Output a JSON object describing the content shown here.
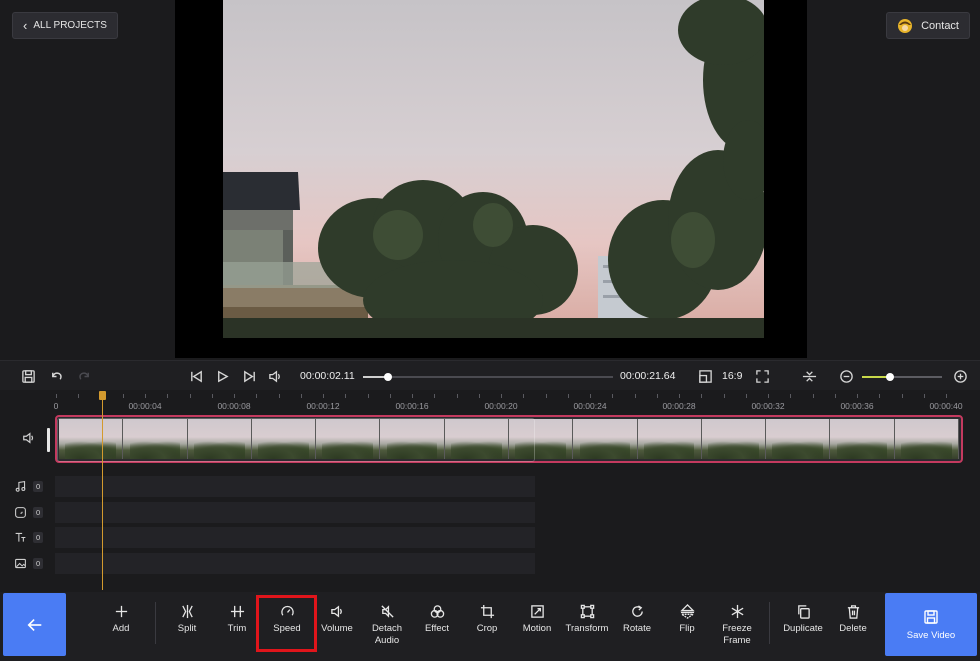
{
  "header": {
    "all_projects_label": "ALL PROJECTS",
    "contact_label": "Contact"
  },
  "playbar": {
    "current_time": "00:00:02.11",
    "total_time": "00:00:21.64",
    "progress_fraction": 0.1,
    "aspect_ratio": "16:9",
    "zoom_fraction": 0.35
  },
  "timeline": {
    "ruler_ticks": [
      "0",
      "00:00:04",
      "00:00:08",
      "00:00:12",
      "00:00:16",
      "00:00:20",
      "00:00:24",
      "00:00:28",
      "00:00:32",
      "00:00:36",
      "00:00:40"
    ],
    "sub_tracks": [
      {
        "icon": "music-icon",
        "count": "0"
      },
      {
        "icon": "sticker-icon",
        "count": "0"
      },
      {
        "icon": "text-icon",
        "count": "0"
      },
      {
        "icon": "image-icon",
        "count": "0"
      }
    ]
  },
  "toolbar": {
    "tools": [
      {
        "id": "add",
        "label": "Add"
      },
      {
        "id": "split",
        "label": "Split"
      },
      {
        "id": "trim",
        "label": "Trim"
      },
      {
        "id": "speed",
        "label": "Speed"
      },
      {
        "id": "volume",
        "label": "Volume"
      },
      {
        "id": "detach-audio",
        "label": "Detach\nAudio"
      },
      {
        "id": "effect",
        "label": "Effect"
      },
      {
        "id": "crop",
        "label": "Crop"
      },
      {
        "id": "motion",
        "label": "Motion"
      },
      {
        "id": "transform",
        "label": "Transform"
      },
      {
        "id": "rotate",
        "label": "Rotate"
      },
      {
        "id": "flip",
        "label": "Flip"
      },
      {
        "id": "freeze-frame",
        "label": "Freeze\nFrame"
      },
      {
        "id": "duplicate",
        "label": "Duplicate"
      },
      {
        "id": "delete",
        "label": "Delete"
      }
    ],
    "save_video_label": "Save Video"
  },
  "colors": {
    "accent_blue": "#4a7cf4",
    "track_border": "#c43a5f",
    "playhead": "#d39a2e",
    "zoom_accent": "#c8d94a",
    "highlight_red": "#e0151b"
  }
}
